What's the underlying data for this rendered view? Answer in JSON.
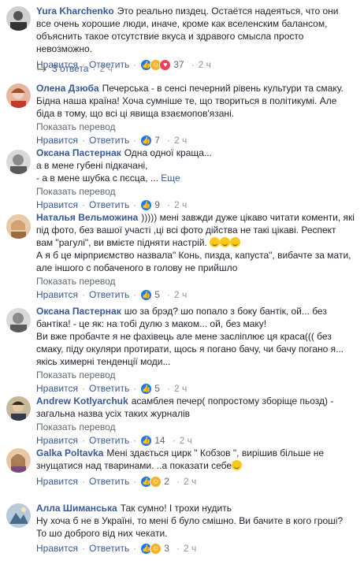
{
  "comments": [
    {
      "author": "Yura Kharchenko",
      "text": "Это реально пиздец. Остаётся надеяться, что они все очень хорошие люди, иначе, кроме как вселенским балансом, объяснить такое отсутствие вкуса и здравого смысла просто невозможно.",
      "like": "Нравится",
      "reply": "Ответить",
      "reactions_count": "37",
      "time": "2 ч",
      "replies": "3 ответа",
      "replies_time": "2 ч"
    },
    {
      "author": "Олена Дзюба",
      "text": "Печерська - в сенсі печерний рівень культури та смаку. Бідна наша країна! Хоча сумніше те, що твориться в політикумі. Але біда в тому, що всі ці явища взаємопов'язані.",
      "translate": "Показать перевод",
      "like": "Нравится",
      "reply": "Ответить",
      "reactions_count": "7",
      "time": "2 ч"
    },
    {
      "author": "Оксана Пастернак",
      "text_lines": [
        "Одна одної краща...",
        "а в мене губені підкачані,",
        "- а в мене шубка с пєсца, ..."
      ],
      "more": "Еще",
      "translate": "Показать перевод",
      "like": "Нравится",
      "reply": "Ответить",
      "reactions_count": "9",
      "time": "2 ч"
    },
    {
      "author": "Наталья Вельможина",
      "text_a": ")))))  мені завжди дуже цікаво читати коменти, які під фото, без вашої участі ,ці всі фото дійства не такі цікаві. Респект вам \"рагулі\", ви вмієте підняти настрій.",
      "text_b": "А я б це мірприємство назвала\" Конь, пизда, капуста\", вибачте за мати, але іншого с побаченого в голову не прийшло",
      "translate": "Показать перевод",
      "like": "Нравится",
      "reply": "Ответить",
      "reactions_count": "5",
      "time": "2 ч"
    },
    {
      "author": "Оксана Пастернак",
      "text_a": "шо за брэд? шо попало з боку бантік, ой... без бантіка! - це як: на тобі дулю з маком... ой, без маку!",
      "text_b": "Ви вже пробачте я не фахівець але мене засліплює ця краса((( без смаку, піду окуляри протирати, щось я погано бачу, чи бачу погано я... якісь химерні тенденції моди...",
      "translate": "Показать перевод",
      "like": "Нравится",
      "reply": "Ответить",
      "reactions_count": "5",
      "time": "2 ч"
    },
    {
      "author": "Andrew Kotlyarchuk",
      "text": "асамблея печер( попростому зборіще пьозд) - загальна назва усіх таких журналів",
      "translate": "Показать перевод",
      "like": "Нравится",
      "reply": "Ответить",
      "reactions_count": "14",
      "time": "2 ч"
    },
    {
      "author": "Galka Poltavka",
      "text": "Мені здається цирк \" Кобзов \", вирішив більше не знущатися над тваринами. ..а показати себе",
      "like": "Нравится",
      "reply": "Ответить",
      "reactions_count": "2",
      "time": "2 ч"
    },
    {
      "author": "Алла Шиманська",
      "text_a": "Так сумно! І трохи нудить",
      "text_b": "Ну хоча б не в Україні, то мені б було смішно. Ви бачите в кого гроші? То шо доброго від них чекати.",
      "like": "Нравится",
      "reply": "Ответить",
      "reactions_count": "3",
      "time": "2 ч"
    }
  ],
  "colors": {
    "link": "#385898",
    "meta": "#606770",
    "like": "#1877f2",
    "haha": "#f7b125",
    "love": "#f33e58"
  }
}
